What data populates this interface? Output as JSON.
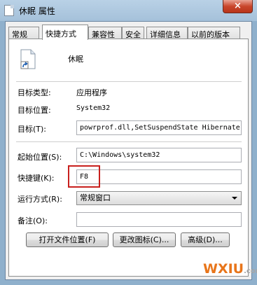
{
  "window": {
    "title": "休眠 属性",
    "close_symbol": "×"
  },
  "tabs": [
    {
      "label": "常规"
    },
    {
      "label": "快捷方式"
    },
    {
      "label": "兼容性"
    },
    {
      "label": "安全"
    },
    {
      "label": "详细信息"
    },
    {
      "label": "以前的版本"
    }
  ],
  "shortcut_name": "休眠",
  "properties": {
    "target_type_label": "目标类型:",
    "target_type_value": "应用程序",
    "target_location_label": "目标位置:",
    "target_location_value": "System32",
    "target_label": "目标(T):",
    "target_value": "powrprof.dll,SetSuspendState Hibernate",
    "start_in_label": "起始位置(S):",
    "start_in_value": "C:\\Windows\\system32",
    "shortcut_key_label": "快捷键(K):",
    "shortcut_key_value": "F8",
    "run_label": "运行方式(R):",
    "run_value": "常规窗口",
    "comment_label": "备注(O):",
    "comment_value": ""
  },
  "buttons": {
    "open_location": "打开文件位置(F)",
    "change_icon": "更改图标(C)...",
    "advanced": "高级(D)..."
  },
  "watermark": {
    "brand": "WXIU",
    "domain": ".com"
  }
}
